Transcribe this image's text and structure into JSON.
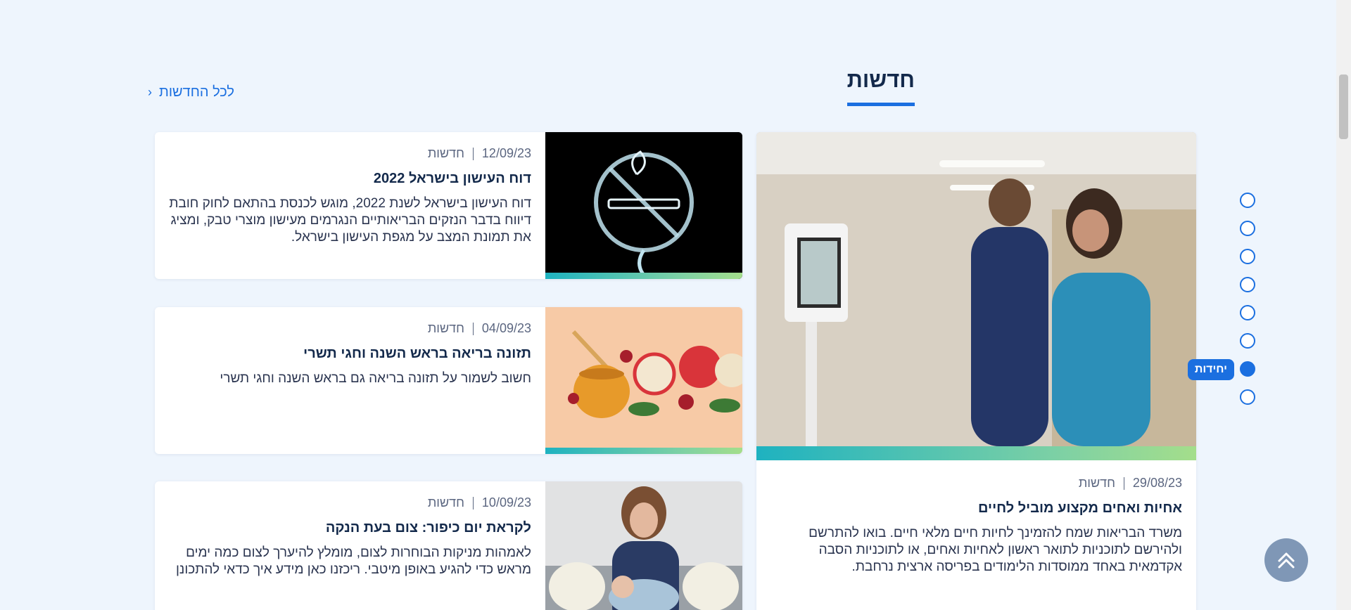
{
  "section": {
    "title": "חדשות",
    "all_news_label": "לכל החדשות"
  },
  "featured": {
    "date": "29/08/23",
    "category": "חדשות",
    "title": "אחיות ואחים מקצוע מוביל לחיים",
    "description": "משרד הבריאות שמח להזמינך לחיות חיים מלאי חיים. בואו להתרשם ולהירשם לתוכניות לתואר ראשון לאחיות ואחים, או לתוכניות הסבה אקדמאית באחד ממוסדות הלימודים בפריסה ארצית נרחבת."
  },
  "cards": [
    {
      "date": "12/09/23",
      "category": "חדשות",
      "title": "דוח העישון בישראל 2022",
      "description": "דוח העישון בישראל לשנת 2022, מוגש לכנסת בהתאם לחוק חובת דיווח בדבר הנזקים הבריאותיים הנגרמים מעישון מוצרי טבק, ומציג את תמונת המצב על מגפת העישון בישראל."
    },
    {
      "date": "04/09/23",
      "category": "חדשות",
      "title": "תזונה בריאה בראש השנה וחגי תשרי",
      "description": "חשוב לשמור על תזונה בריאה גם בראש השנה וחגי תשרי"
    },
    {
      "date": "10/09/23",
      "category": "חדשות",
      "title": "לקראת יום כיפור: צום בעת הנקה",
      "description": "לאמהות מניקות הבוחרות לצום, מומלץ להיערך לצום כמה ימים מראש כדי להגיע באופן מיטבי. ריכזנו כאן מידע איך כדאי להתכונן"
    }
  ],
  "dot_nav": {
    "count": 8,
    "active_index": 6,
    "active_label": "יחידות"
  },
  "colors": {
    "accent": "#1b6fe0",
    "background": "#eef5fd",
    "title": "#13294b"
  }
}
